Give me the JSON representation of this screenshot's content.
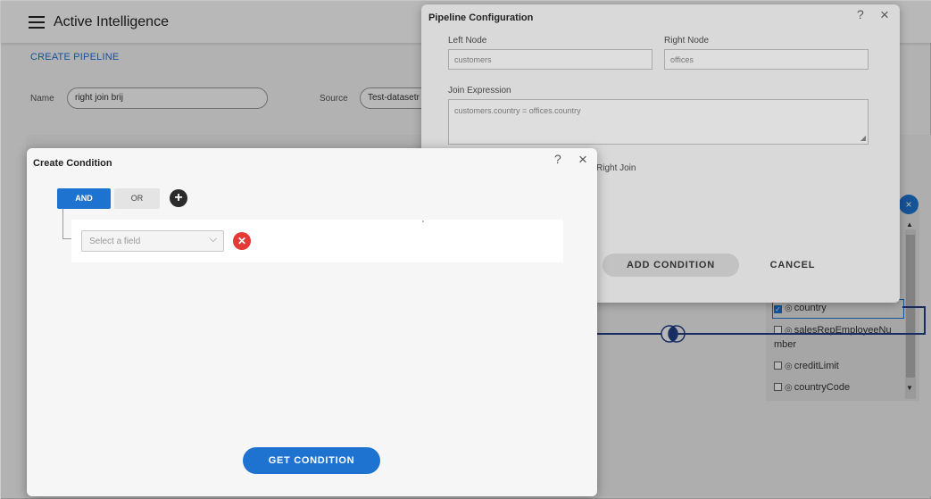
{
  "app": {
    "title": "Active Intelligence",
    "page_link": "CREATE PIPELINE",
    "name_label": "Name",
    "name_value": "right join brij",
    "source_label": "Source",
    "source_value": "Test-datasetr"
  },
  "fields_panel": {
    "items": [
      {
        "label": "country",
        "checked": true
      },
      {
        "label": "salesRepEmployeeNu",
        "label_cont": "mber",
        "checked": false
      },
      {
        "label": "creditLimit",
        "checked": false
      },
      {
        "label": "countryCode",
        "checked": false
      }
    ],
    "close_glyph": "×",
    "scroll_up": "▲",
    "scroll_down": "▼"
  },
  "pipeline_dialog": {
    "title": "Pipeline Configuration",
    "help_glyph": "?",
    "close_glyph": "×",
    "left_node_label": "Left Node",
    "left_node_value": "customers",
    "right_node_label": "Right Node",
    "right_node_value": "offices",
    "join_expression_label": "Join Expression",
    "join_expression_value": "customers.country = offices.country",
    "join_type_text": "Right Join",
    "add_condition_label": "ADD CONDITION",
    "cancel_label": "CANCEL"
  },
  "condition_dialog": {
    "title": "Create Condition",
    "help_glyph": "?",
    "close_glyph": "×",
    "and_label": "AND",
    "or_label": "OR",
    "add_glyph": "+",
    "field_placeholder": "Select a field",
    "chevron_glyph": "⌵",
    "remove_glyph": "✕",
    "get_condition_label": "GET CONDITION"
  },
  "colors": {
    "accent": "#1e73d1",
    "danger": "#e53935",
    "link_line": "#20408a"
  }
}
